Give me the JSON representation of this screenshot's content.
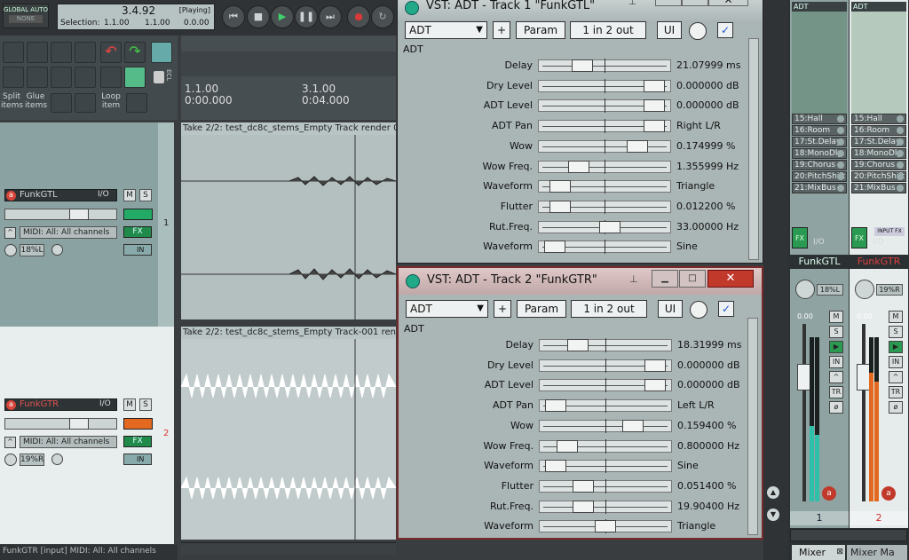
{
  "transport": {
    "global_auto_label": "GLOBAL AUTO",
    "global_auto_value": "NONE",
    "time": "3.4.92",
    "state": "[Playing]",
    "selection_label": "Selection:",
    "sel_start": "1.1.00",
    "sel_end": "1.1.00",
    "sel_len": "0.0.00"
  },
  "toolbar": {
    "split_items": "Split items",
    "glue_items": "Glue items",
    "loop_item": "Loop item",
    "ecl": "ECL"
  },
  "ruler": {
    "m1": "1.1.00",
    "t1": "0:00.000",
    "m2": "3.1.00",
    "t2": "0:04.000",
    "edge": "1"
  },
  "tracks": [
    {
      "name": "FunkGTL",
      "io": "I/O",
      "m": "M",
      "s": "S",
      "midi": "MIDI: All: All channels",
      "fx": "FX",
      "pan": "18%L",
      "in": "IN",
      "num": "1",
      "take": "Take 2/2: test_dc8c_stems_Empty Track render 001"
    },
    {
      "name": "FunkGTR",
      "io": "I/O",
      "m": "M",
      "s": "S",
      "midi": "MIDI: All: All channels",
      "fx": "FX",
      "pan": "19%R",
      "in": "IN",
      "num": "2",
      "take": "Take 2/2: test_dc8c_stems_Empty Track-001 render"
    }
  ],
  "status": "FunkGTR [input] MIDI: All: All channels",
  "vst1": {
    "title": "VST: ADT - Track 1 \"FunkGTL\"",
    "preset": "ADT",
    "plus": "+",
    "param": "Param",
    "io": "1 in 2 out",
    "ui": "UI",
    "check": "✓",
    "plugin": "ADT",
    "params": [
      {
        "label": "Delay",
        "value": "21.07999 ms",
        "pos": 0.3
      },
      {
        "label": "Dry Level",
        "value": "0.000000 dB",
        "pos": 0.95
      },
      {
        "label": "ADT Level",
        "value": "0.000000 dB",
        "pos": 0.95
      },
      {
        "label": "ADT Pan",
        "value": "Right L/R",
        "pos": 0.95
      },
      {
        "label": "Wow",
        "value": "0.174999 %",
        "pos": 0.8
      },
      {
        "label": "Wow Freq.",
        "value": "1.355999 Hz",
        "pos": 0.27
      },
      {
        "label": "Waveform",
        "value": "Triangle",
        "pos": 0.1
      },
      {
        "label": "Flutter",
        "value": "0.012200 %",
        "pos": 0.1
      },
      {
        "label": "Rut.Freq.",
        "value": "33.00000 Hz",
        "pos": 0.55
      },
      {
        "label": "Waveform",
        "value": "Sine",
        "pos": 0.05
      }
    ]
  },
  "vst2": {
    "title": "VST: ADT - Track 2 \"FunkGTR\"",
    "preset": "ADT",
    "plus": "+",
    "param": "Param",
    "io": "1 in 2 out",
    "ui": "UI",
    "check": "✓",
    "plugin": "ADT",
    "params": [
      {
        "label": "Delay",
        "value": "18.31999 ms",
        "pos": 0.25
      },
      {
        "label": "Dry Level",
        "value": "0.000000 dB",
        "pos": 0.95
      },
      {
        "label": "ADT Level",
        "value": "0.000000 dB",
        "pos": 0.95
      },
      {
        "label": "ADT Pan",
        "value": "Left L/R",
        "pos": 0.05
      },
      {
        "label": "Wow",
        "value": "0.159400 %",
        "pos": 0.75
      },
      {
        "label": "Wow Freq.",
        "value": "0.800000 Hz",
        "pos": 0.15
      },
      {
        "label": "Waveform",
        "value": "Sine",
        "pos": 0.05
      },
      {
        "label": "Flutter",
        "value": "0.051400 %",
        "pos": 0.3
      },
      {
        "label": "Rut.Freq.",
        "value": "19.90400 Hz",
        "pos": 0.3
      },
      {
        "label": "Waveform",
        "value": "Triangle",
        "pos": 0.5
      }
    ]
  },
  "mixer": {
    "strips": [
      {
        "top": "ADT",
        "name": "FunkGTL",
        "pan": "18%L",
        "db": "0.00",
        "num": "1",
        "sends": [
          "15:Hall",
          "16:Room",
          "17:St.Delay",
          "18:MonoDly",
          "19:Chorus",
          "20:PitchShift",
          "21:MixBus"
        ],
        "route": "I/O"
      },
      {
        "top": "ADT",
        "name": "FunkGTR",
        "pan": "19%R",
        "db": "0.00",
        "num": "2",
        "sends": [
          "15:Hall",
          "16:Room",
          "17:St.Delay",
          "18:MonoDly",
          "19:Chorus",
          "20:PitchShift",
          "21:MixBus"
        ],
        "route": "I/O",
        "input_fx": "INPUT FX"
      }
    ],
    "tab1": "Mixer",
    "tab2": "Mixer Ma"
  }
}
